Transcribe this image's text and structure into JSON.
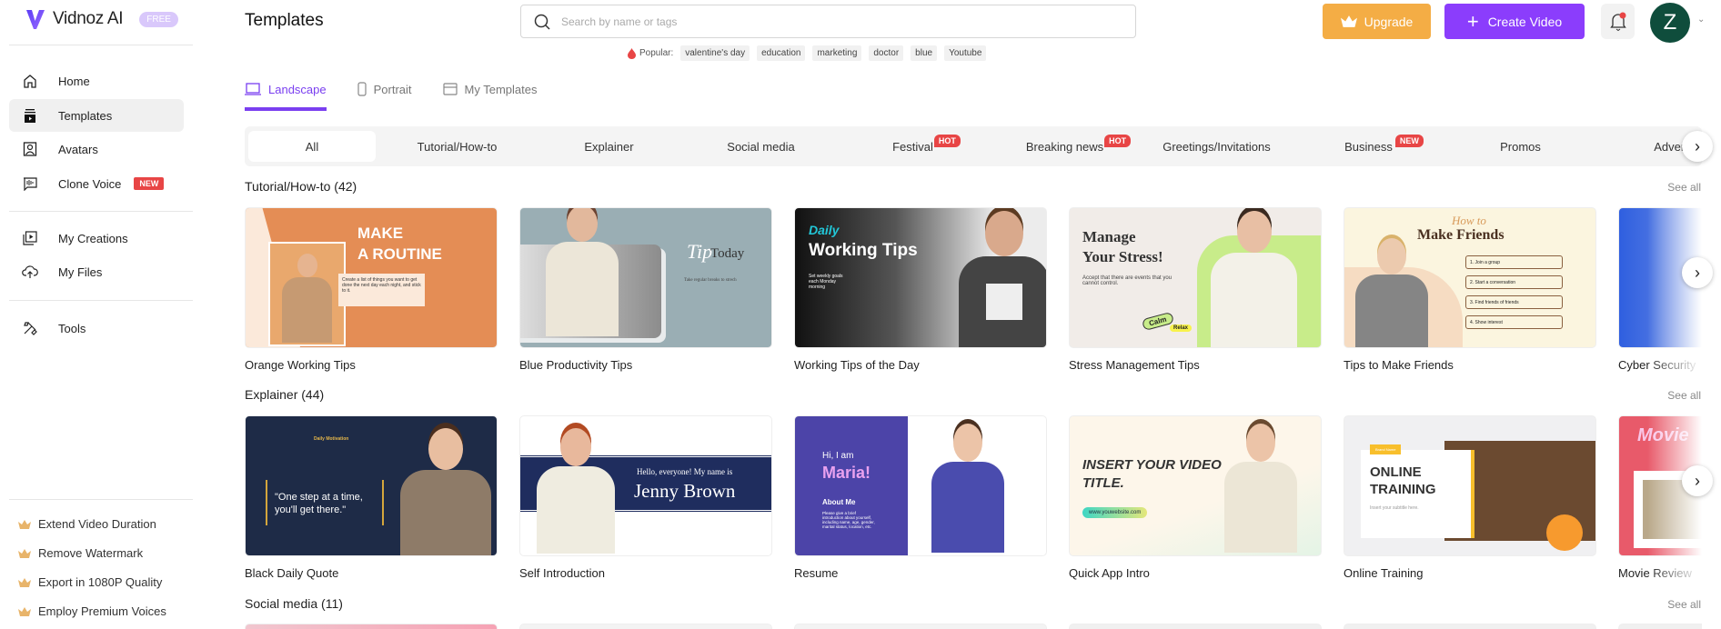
{
  "brand": {
    "name": "Vidnoz AI",
    "plan_badge": "FREE",
    "accent": "#8b3dfc"
  },
  "sidebar": {
    "items": [
      {
        "label": "Home",
        "icon": "home-icon"
      },
      {
        "label": "Templates",
        "icon": "templates-icon",
        "active": true
      },
      {
        "label": "Avatars",
        "icon": "avatar-icon"
      },
      {
        "label": "Clone Voice",
        "icon": "voice-icon",
        "badge": "NEW"
      },
      {
        "label": "My Creations",
        "icon": "video-library-icon"
      },
      {
        "label": "My Files",
        "icon": "cloud-upload-icon"
      },
      {
        "label": "Tools",
        "icon": "tools-icon"
      }
    ],
    "perks": [
      "Extend Video Duration",
      "Remove Watermark",
      "Export in 1080P Quality",
      "Employ Premium Voices"
    ]
  },
  "header": {
    "title": "Templates",
    "search_placeholder": "Search by name or tags",
    "popular_label": "Popular:",
    "popular_tags": [
      "valentine's day",
      "education",
      "marketing",
      "doctor",
      "blue",
      "Youtube"
    ],
    "upgrade": "Upgrade",
    "create_video": "Create Video",
    "avatar_initial": "Z"
  },
  "tabs": [
    {
      "label": "Landscape",
      "active": true
    },
    {
      "label": "Portrait"
    },
    {
      "label": "My Templates"
    }
  ],
  "categories": [
    {
      "label": "All",
      "active": true
    },
    {
      "label": "Tutorial/How-to"
    },
    {
      "label": "Explainer"
    },
    {
      "label": "Social media"
    },
    {
      "label": "Festival",
      "badge": "HOT"
    },
    {
      "label": "Breaking news",
      "badge": "HOT"
    },
    {
      "label": "Greetings/Invitations"
    },
    {
      "label": "Business",
      "badge": "NEW"
    },
    {
      "label": "Promos"
    },
    {
      "label": "Adverti"
    }
  ],
  "sections": [
    {
      "title": "Tutorial/How-to (42)",
      "see_all": "See all",
      "cards": [
        {
          "label": "Orange Working Tips",
          "thumb": [
            "MAKE",
            "A ROUTINE",
            "Create a list of things you want to get done the next day each night, and stick to it."
          ]
        },
        {
          "label": "Blue Productivity Tips",
          "thumb": [
            "Tip",
            "Today",
            "Take regular breaks to strech"
          ]
        },
        {
          "label": "Working Tips of the Day",
          "thumb": [
            "Daily",
            "Working Tips",
            "Set weekly goals each Monday morning"
          ]
        },
        {
          "label": "Stress Management Tips",
          "thumb": [
            "Manage",
            "Your Stress!",
            "Accept that there are events that you cannot control.",
            "Calm",
            "Relax"
          ]
        },
        {
          "label": "Tips to Make Friends",
          "thumb": [
            "How to",
            "Make Friends",
            "1. Join a group",
            "2. Start a conversation",
            "3. Find friends of friends",
            "4. Show interest"
          ]
        },
        {
          "label": "Cyber Security",
          "thumb": []
        }
      ]
    },
    {
      "title": "Explainer (44)",
      "see_all": "See all",
      "cards": [
        {
          "label": "Black Daily Quote",
          "thumb": [
            "Daily Motivation",
            "\"One step at a time, you'll get there.\""
          ]
        },
        {
          "label": "Self Introduction",
          "thumb": [
            "Hello, everyone! My name is",
            "Jenny Brown"
          ]
        },
        {
          "label": "Resume",
          "thumb": [
            "Hi, I am",
            "Maria!",
            "About Me",
            "Please give a brief introduction about yourself, including name, age, gender, marital status, location, etc."
          ]
        },
        {
          "label": "Quick App Intro",
          "thumb": [
            "INSERT YOUR VIDEO TITLE.",
            "www.youwebsite.com"
          ]
        },
        {
          "label": "Online Training",
          "thumb": [
            "Brand Name",
            "ONLINE TRAINING",
            "Insert your subtitle here."
          ]
        },
        {
          "label": "Movie Review",
          "thumb": [
            "Movie"
          ]
        }
      ]
    },
    {
      "title": "Social media (11)",
      "see_all": "See all",
      "cards": []
    }
  ]
}
